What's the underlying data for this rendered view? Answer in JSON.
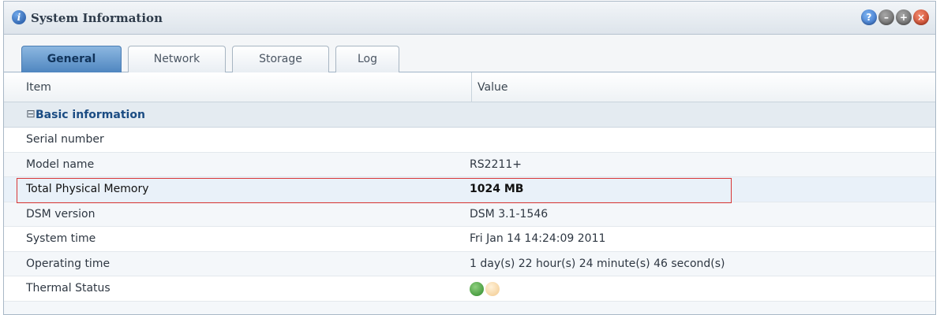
{
  "window": {
    "title": "System Information",
    "title_icon": "info-icon"
  },
  "titlebar_buttons": [
    {
      "name": "help-icon",
      "glyph": "?"
    },
    {
      "name": "minimize-icon",
      "glyph": "–"
    },
    {
      "name": "maximize-icon",
      "glyph": "+"
    },
    {
      "name": "close-icon",
      "glyph": "×"
    }
  ],
  "tabs": [
    {
      "label": "General",
      "active": true
    },
    {
      "label": "Network",
      "active": false
    },
    {
      "label": "Storage",
      "active": false
    },
    {
      "label": "Log",
      "active": false
    }
  ],
  "grid": {
    "columns": {
      "item": "Item",
      "value": "Value"
    },
    "group": {
      "expander": "⊟",
      "label": "Basic information"
    },
    "rows": [
      {
        "item": "Serial number",
        "value": ""
      },
      {
        "item": "Model name",
        "value": "RS2211+"
      },
      {
        "item": "Total Physical Memory",
        "value": "1024 MB"
      },
      {
        "item": "DSM version",
        "value": "DSM 3.1-1546"
      },
      {
        "item": "System time",
        "value": "Fri Jan 14 14:24:09 2011"
      },
      {
        "item": "Operating time",
        "value": "1 day(s) 22 hour(s) 24 minute(s) 46 second(s)"
      },
      {
        "item": "Thermal Status",
        "value": ""
      }
    ]
  },
  "thermal_status": {
    "indicators": [
      "green-status-icon",
      "amber-status-icon"
    ],
    "colors": [
      "#2f8a2a",
      "#f2c98d"
    ]
  },
  "highlight_color": "#d93636"
}
